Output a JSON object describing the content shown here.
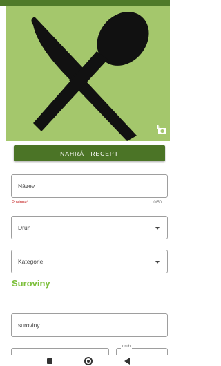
{
  "colors": {
    "primary": "#4b7426",
    "hero_bg": "#a4c76c",
    "accent_text": "#7cbf3a",
    "required": "#c62828"
  },
  "hero": {
    "icon": "fork-knife-spoon-icon",
    "camera_icon": "camera-add-icon"
  },
  "upload_button": {
    "label": "NAHRÁT RECEPT"
  },
  "form": {
    "name": {
      "placeholder": "Název",
      "required_label": "Povinné*",
      "counter": "0/50"
    },
    "type": {
      "label": "Druh"
    },
    "category": {
      "label": "Kategorie"
    },
    "section_title": "Suroviny",
    "ingredients": {
      "placeholder": "suroviny"
    },
    "partial_label": "druh"
  },
  "navbar": {
    "icons": [
      "recents-icon",
      "home-icon",
      "back-icon"
    ]
  }
}
